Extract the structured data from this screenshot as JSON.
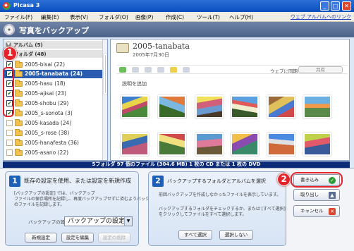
{
  "window": {
    "title": "Picasa 3",
    "min": "_",
    "max": "□",
    "close": "✕"
  },
  "menu": {
    "items": [
      "ファイル(F)",
      "編集(E)",
      "表示(V)",
      "フォルダ(O)",
      "画像(P)",
      "作成(C)",
      "ツール(T)",
      "ヘルプ(H)"
    ],
    "web_album_link": "ウェブ アルバムへのリンク"
  },
  "header": {
    "title": "写真をバックアップ",
    "icon": "cd-disc-icon"
  },
  "left_panel": {
    "albums_label": "アルバム (5)",
    "folders_label": "フォルダ (48)",
    "folders": [
      {
        "name": "2005-bisai (22)",
        "checked": true
      },
      {
        "name": "2005-tanabata (24)",
        "checked": true,
        "selected": true
      },
      {
        "name": "2005-hasu (18)",
        "checked": true
      },
      {
        "name": "2005-ajisai (23)",
        "checked": true
      },
      {
        "name": "2005-shobu (29)",
        "checked": true
      },
      {
        "name": "2005_s-sonota (3)",
        "checked": true
      },
      {
        "name": "2005-kasada (24)",
        "checked": false
      },
      {
        "name": "2005_s-rose (38)",
        "checked": false
      },
      {
        "name": "2005-hanafesta (36)",
        "checked": false
      },
      {
        "name": "2005-asano (22)",
        "checked": false
      }
    ]
  },
  "album": {
    "title": "2005-tanabata",
    "date": "2005年7月30日",
    "caption_placeholder": "説明を追加",
    "web_album_label": "ウェブに同期",
    "share_label": "共有"
  },
  "status": {
    "text": "5フォルダ 97 個のファイル (304.6 MB) 1 枚の CD または 1 枚の DVD"
  },
  "step1": {
    "number": "1",
    "title": "既存の設定を使用、または設定を新規作成",
    "description": [
      "[バックアップの設定] では、バックアップ",
      "ファイルの保存場所を記録し、再度バックアップせずに済むようバックアップ済み",
      "のファイルを記録します。"
    ],
    "setting_label": "バックアップの設定",
    "setting_value": "バックアップの設定",
    "new_button": "新規設定",
    "edit_button": "設定を編集",
    "delete_button": "設定の削除"
  },
  "step2": {
    "number": "2",
    "title": "バックアップするフォルダとアルバムを選択",
    "text1": "前回バックアップを作成しなかったファイルを表示しています。",
    "text2": [
      "バックアップするフォルダをチェックするか、または [すべて選択]",
      "をクリックしてファイルをすべて選択します。"
    ],
    "select_all_button": "すべて選択",
    "select_none_button": "選択しない"
  },
  "side_buttons": {
    "burn": "書き込み",
    "eject": "取り出し",
    "cancel": "キャンセル"
  },
  "callouts": {
    "one": "1",
    "two": "2"
  },
  "colors": {
    "accent": "#2a5db0",
    "callout": "#e3242b",
    "status_bg": "#0b2a78"
  }
}
